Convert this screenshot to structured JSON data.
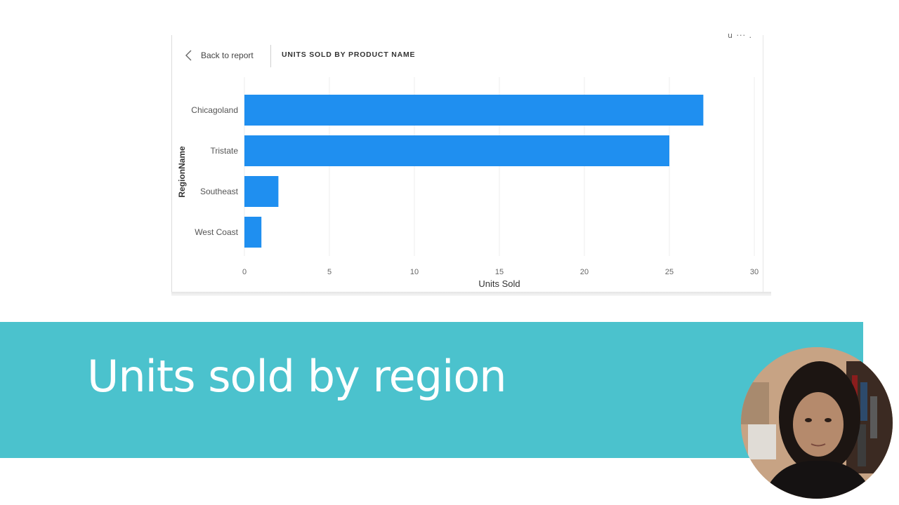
{
  "report": {
    "back_label": "Back to report",
    "title": "UNITS SOLD BY PRODUCT NAME",
    "top_right_text": "u ··· ."
  },
  "chart_data": {
    "type": "bar",
    "orientation": "horizontal",
    "categories": [
      "Chicagoland",
      "Tristate",
      "Southeast",
      "West Coast"
    ],
    "values": [
      27,
      25,
      2,
      1
    ],
    "title": "UNITS SOLD BY PRODUCT NAME",
    "xlabel": "Units Sold",
    "ylabel": "RegionName",
    "xlim": [
      0,
      30
    ],
    "xticks": [
      0,
      5,
      10,
      15,
      20,
      25,
      30
    ],
    "grid": true,
    "bar_color": "#1f8ff0"
  },
  "slide": {
    "heading": "Units sold by region",
    "banner_color": "#4bc2cd"
  }
}
